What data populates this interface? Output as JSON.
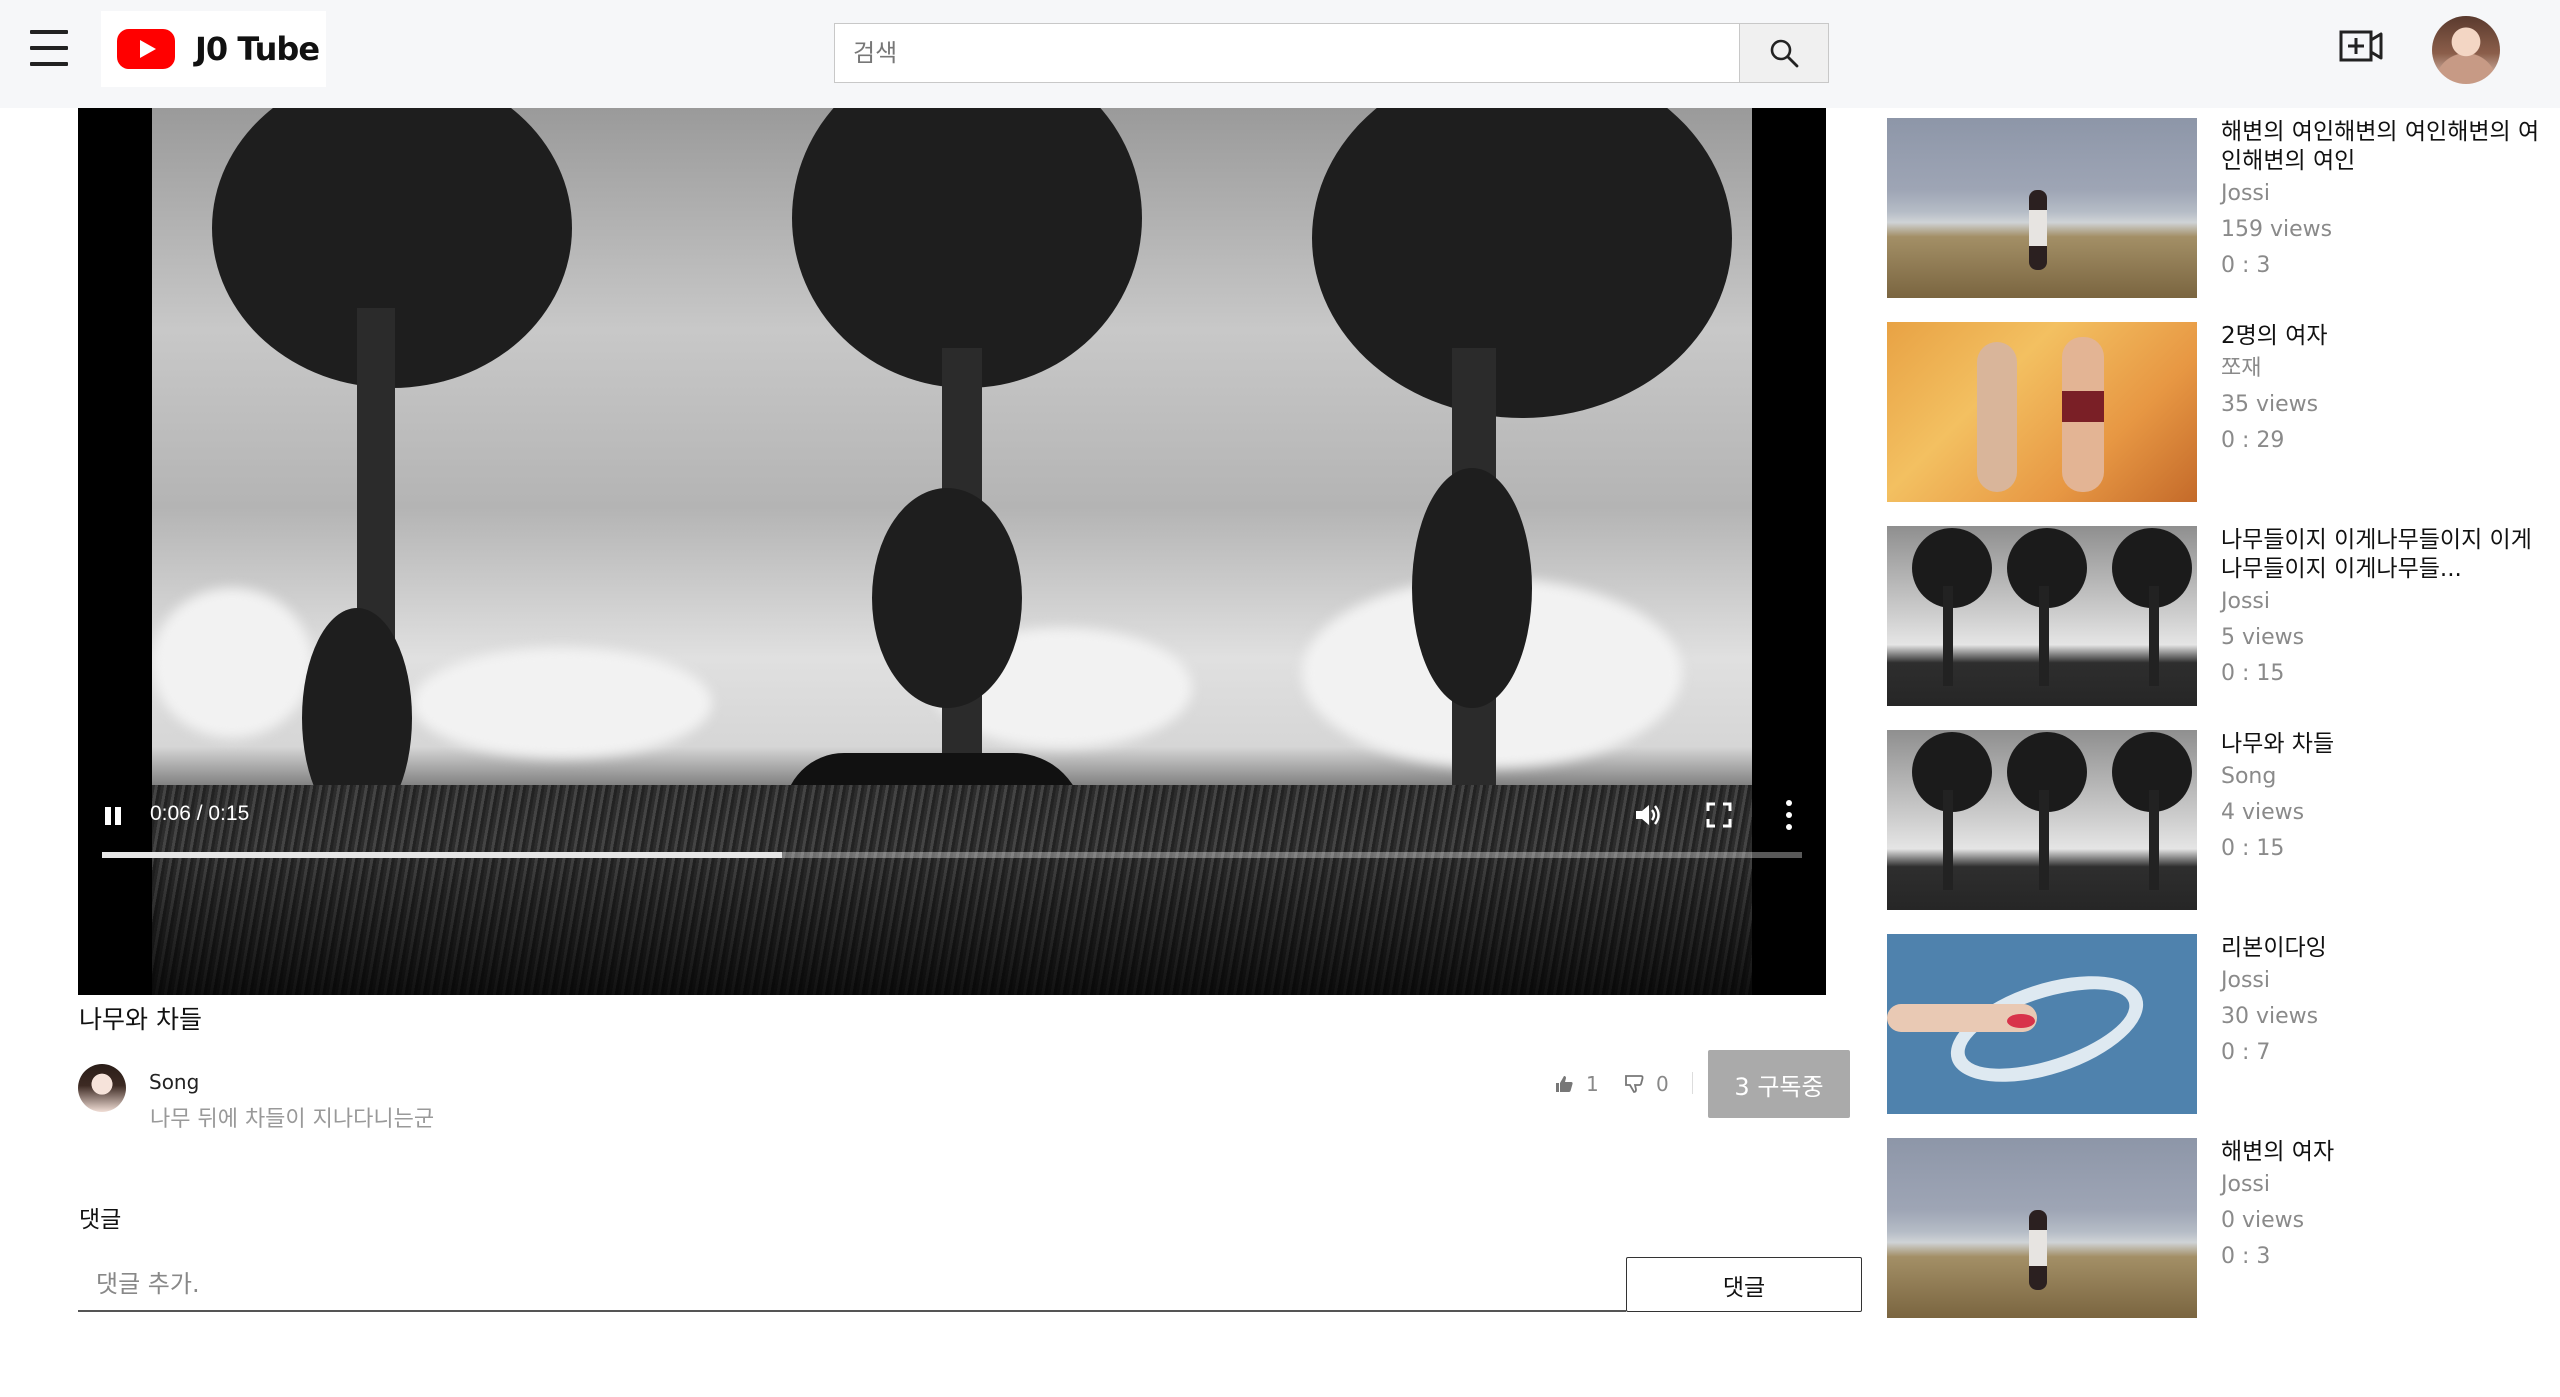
{
  "header": {
    "logo_text": "J0 Tube",
    "search_placeholder": "검색"
  },
  "player": {
    "time": "0:06 / 0:15",
    "progress": 0.4
  },
  "video": {
    "title": "나무와 차들",
    "channel": "Song",
    "description": "나무 뒤에 차들이 지나다니는군",
    "likes": "1",
    "dislikes": "0",
    "subscribe_label": "3 구독중"
  },
  "comments": {
    "heading": "댓글",
    "placeholder": "댓글 추가.",
    "submit_label": "댓글"
  },
  "sidebar": {
    "items": [
      {
        "title": "해변의 여인해변의 여인해변의 여인해변의 여인",
        "channel": "Jossi",
        "views": "159 views",
        "duration": "0 : 3",
        "thumb": "beach"
      },
      {
        "title": "2명의 여자",
        "channel": "쪼재",
        "views": "35 views",
        "duration": "0 : 29",
        "thumb": "orange"
      },
      {
        "title": "나무들이지 이게나무들이지 이게나무들이지 이게나무들...",
        "channel": "Jossi",
        "views": "5 views",
        "duration": "0 : 15",
        "thumb": "trees"
      },
      {
        "title": "나무와 차들",
        "channel": "Song",
        "views": "4 views",
        "duration": "0 : 15",
        "thumb": "trees"
      },
      {
        "title": "리본이다잉",
        "channel": "Jossi",
        "views": "30 views",
        "duration": "0 : 7",
        "thumb": "ribbon"
      },
      {
        "title": "해변의 여자",
        "channel": "Jossi",
        "views": "0 views",
        "duration": "0 : 3",
        "thumb": "beach"
      }
    ]
  }
}
